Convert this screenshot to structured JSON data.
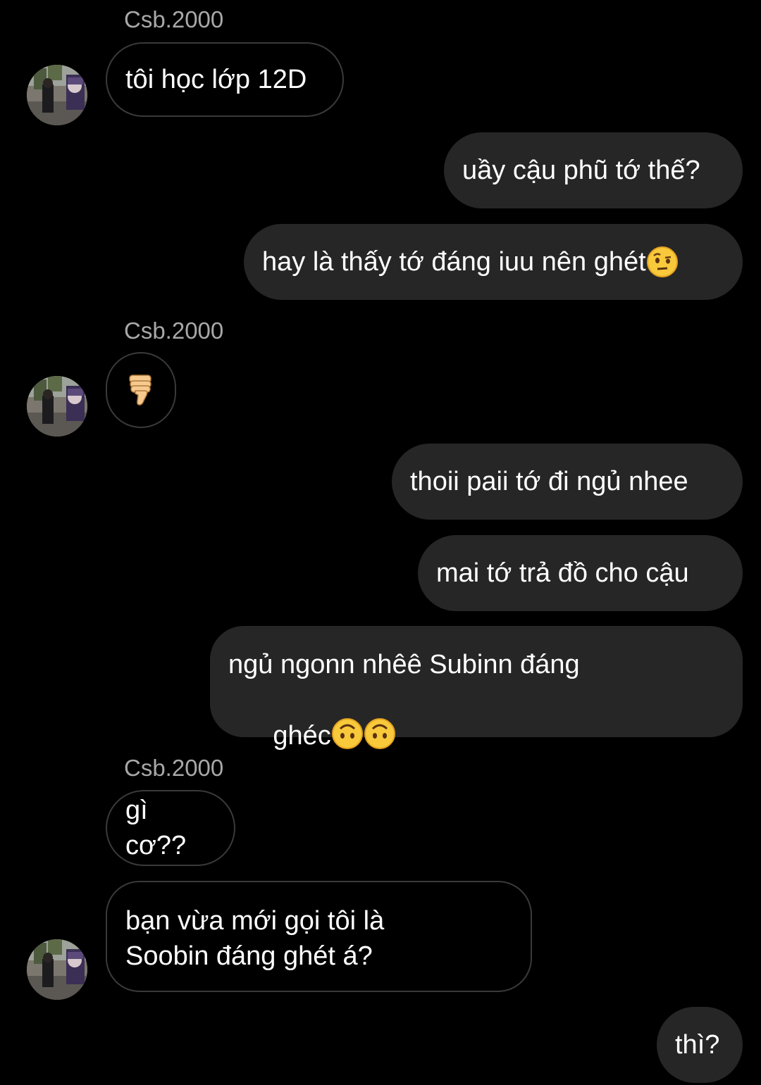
{
  "contact": {
    "name": "Csb.2000"
  },
  "messages": [
    {
      "from": "them",
      "text": "tôi học lớp 12D"
    },
    {
      "from": "me",
      "text": "uầy cậu phũ tớ thế?"
    },
    {
      "from": "me",
      "text": "hay là thấy tớ đáng iuu nên ghét",
      "emoji": "raised-eyebrow-face"
    },
    {
      "from": "them",
      "text": "",
      "emoji": "thumbs-down"
    },
    {
      "from": "me",
      "text": "thoii paii tớ đi ngủ nhee"
    },
    {
      "from": "me",
      "text": "mai tớ trả đồ cho cậu"
    },
    {
      "from": "me",
      "text_line1": "ngủ ngonn nhêê Subinn đáng",
      "text_line2": "ghéc",
      "emoji": "upside-down-face x2"
    },
    {
      "from": "them",
      "text": "gì cơ??"
    },
    {
      "from": "them",
      "text_line1": "bạn vừa mới gọi tôi là",
      "text_line2": "Soobin đáng ghét á?"
    },
    {
      "from": "me",
      "text": "thì?"
    }
  ],
  "colors": {
    "background": "#000000",
    "outgoing_bubble": "#262626",
    "incoming_border": "#3a3a3a",
    "sender_name": "#a8a8a8",
    "text": "#ffffff"
  }
}
